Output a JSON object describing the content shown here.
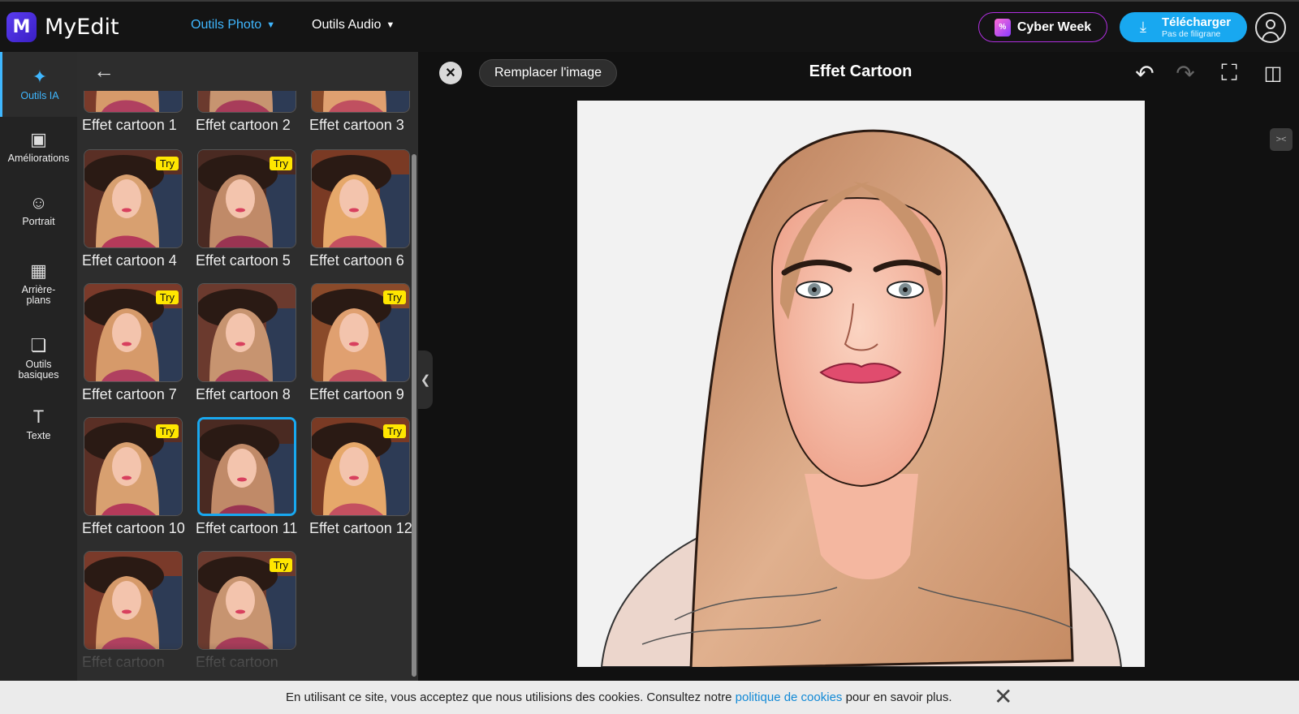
{
  "app": {
    "name": "MyEdit",
    "logo_letter": "M"
  },
  "nav": {
    "photo": "Outils Photo",
    "audio": "Outils Audio",
    "active": "Outils Photo"
  },
  "header": {
    "cyber_week": "Cyber Week",
    "cyber_badge": "%",
    "download": {
      "label": "Télécharger",
      "sub": "Pas de filigrane"
    }
  },
  "sidebar": {
    "items": [
      {
        "label": "Outils IA",
        "icon": "magic-wand-icon",
        "active": true
      },
      {
        "label": "Améliorations",
        "icon": "image-enhance-icon"
      },
      {
        "label": "Portrait",
        "icon": "portrait-icon"
      },
      {
        "label": "Arrière-plans",
        "icon": "background-icon"
      },
      {
        "label": "Outils basiques",
        "icon": "copy-tools-icon"
      },
      {
        "label": "Texte",
        "icon": "text-icon"
      }
    ]
  },
  "effects": {
    "try_label": "Try",
    "selected": "Effet cartoon 11",
    "items": [
      {
        "label": "Effet cartoon 1",
        "try": false
      },
      {
        "label": "Effet cartoon 2",
        "try": false
      },
      {
        "label": "Effet cartoon 3",
        "try": false
      },
      {
        "label": "Effet cartoon 4",
        "try": true
      },
      {
        "label": "Effet cartoon 5",
        "try": true
      },
      {
        "label": "Effet cartoon 6",
        "try": false
      },
      {
        "label": "Effet cartoon 7",
        "try": true
      },
      {
        "label": "Effet cartoon 8",
        "try": false
      },
      {
        "label": "Effet cartoon 9",
        "try": true
      },
      {
        "label": "Effet cartoon 10",
        "try": true
      },
      {
        "label": "Effet cartoon 11",
        "try": false
      },
      {
        "label": "Effet cartoon 12",
        "try": true
      },
      {
        "label": "Effet cartoon",
        "try": false
      },
      {
        "label": "Effet cartoon",
        "try": true
      }
    ]
  },
  "editor": {
    "replace_label": "Remplacer l'image",
    "title": "Effet Cartoon",
    "tools": [
      "undo-icon",
      "redo-icon",
      "crop-icon",
      "compare-icon"
    ]
  },
  "cookie": {
    "text_before": "En utilisant ce site, vous acceptez que nous utilisions des cookies. Consultez notre",
    "link": "politique de cookies",
    "text_after": "pour en savoir plus."
  },
  "colors": {
    "accent": "#18a8f0",
    "link": "#3fb7ff",
    "try_badge": "#ffe600",
    "cyber_border": "#b02fe0"
  }
}
